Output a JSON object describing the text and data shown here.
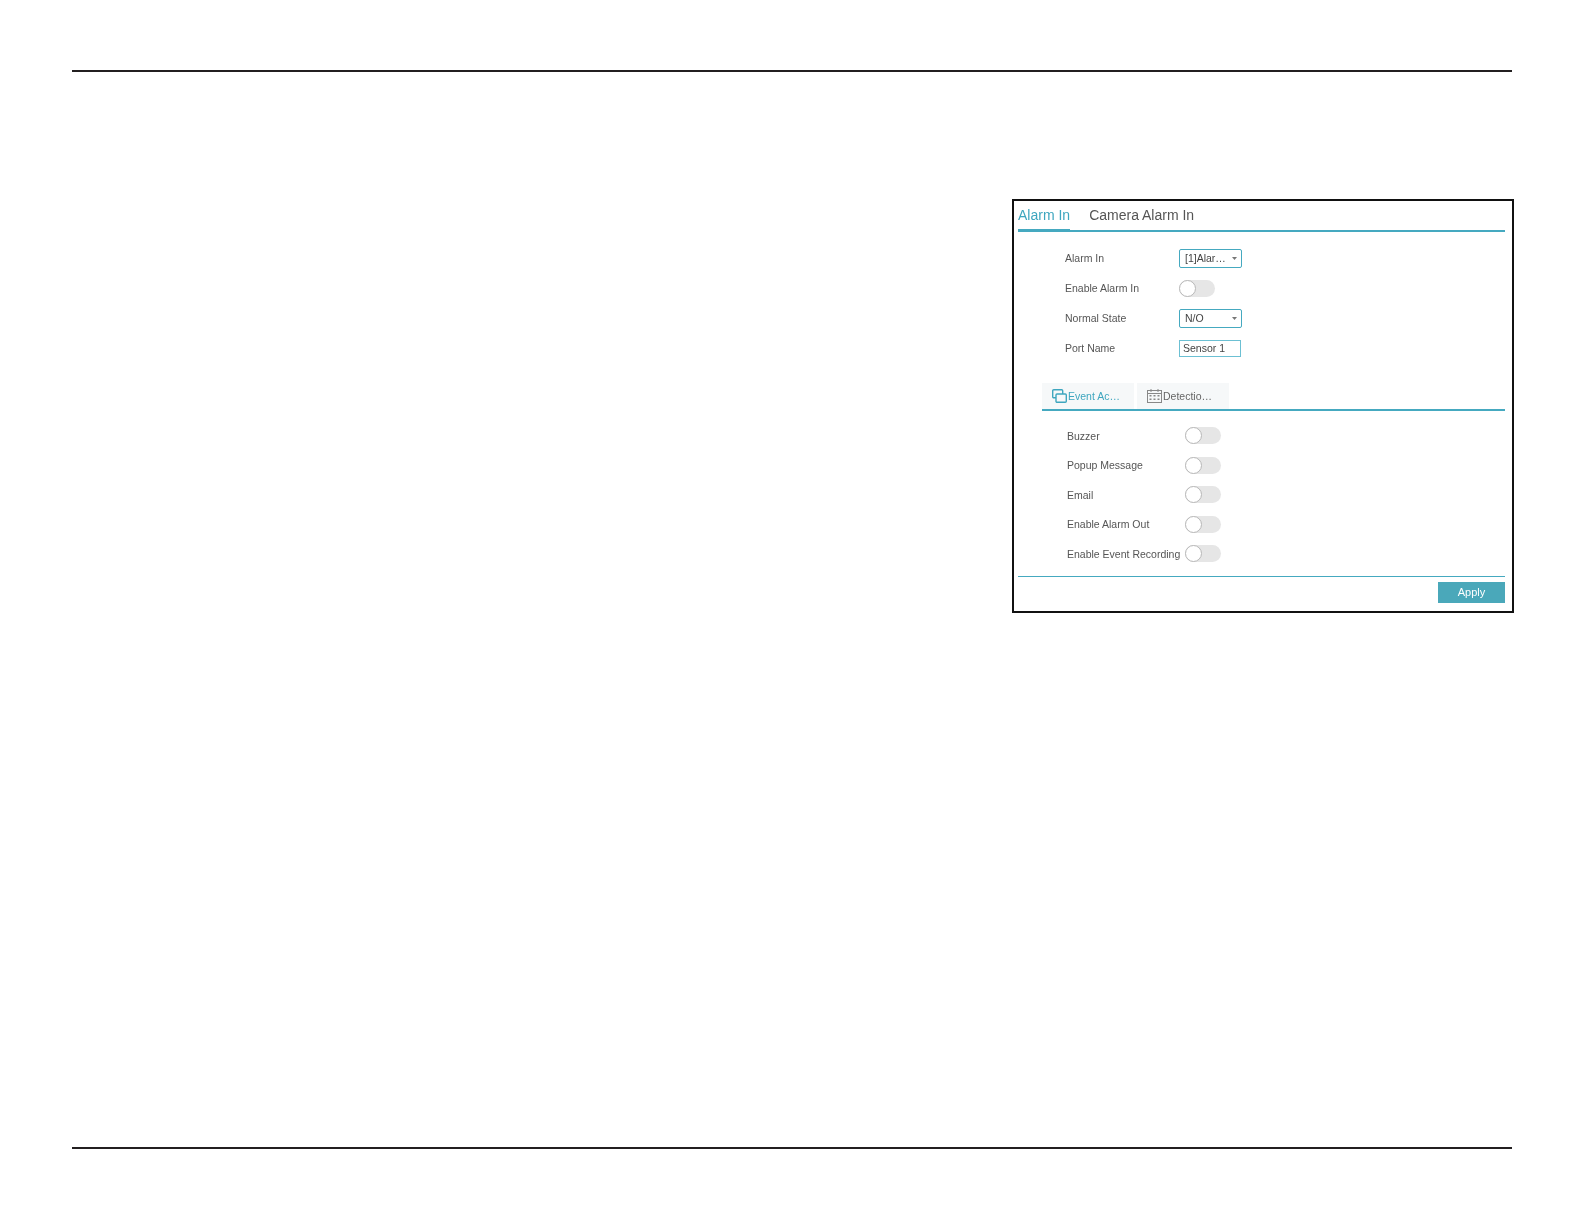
{
  "tabs": [
    {
      "label": "Alarm In",
      "selected": true
    },
    {
      "label": "Camera Alarm In",
      "selected": false
    }
  ],
  "settings": [
    {
      "kind": "dropdown",
      "label": "Alarm In",
      "value": "[1]Alar…"
    },
    {
      "kind": "toggle",
      "label": "Enable Alarm In",
      "on": false
    },
    {
      "kind": "dropdown",
      "label": "Normal State",
      "value": "N/O"
    },
    {
      "kind": "text",
      "label": "Port Name",
      "value": "Sensor 1"
    }
  ],
  "sub_tabs": [
    {
      "kind": "event",
      "label": "Event Ac…",
      "selected": true
    },
    {
      "kind": "schedule",
      "label": "Detectio…",
      "selected": false
    }
  ],
  "actions": [
    {
      "label": "Buzzer",
      "on": false
    },
    {
      "label": "Popup Message",
      "on": false
    },
    {
      "label": "Email",
      "on": false
    },
    {
      "label": "Enable Alarm Out",
      "on": false
    },
    {
      "label": "Enable Event Recording",
      "on": false
    }
  ],
  "apply_button": "Apply"
}
